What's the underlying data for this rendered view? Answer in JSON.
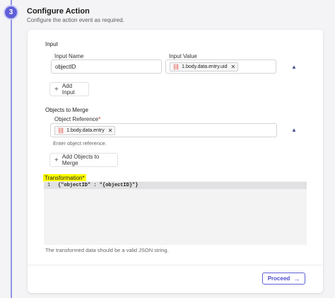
{
  "step": {
    "number": "3",
    "title": "Configure Action",
    "subtitle": "Configure the action event as required."
  },
  "input_section": {
    "title": "Input",
    "name_label": "Input Name",
    "value_label": "Input Value",
    "name_value": "objectID",
    "value_chip": "1.body.data.entry.uid",
    "add_label": "Add Input"
  },
  "merge_section": {
    "title": "Objects to Merge",
    "reference_label": "Object Reference",
    "reference_chip": "1.body.data.entry",
    "help": "Enter object reference.",
    "add_label": "Add Objects to Merge"
  },
  "transformation": {
    "label": "Transformation",
    "line_number": "1",
    "code": "{\"objectID\" : \"{objectID}\"}",
    "help": "The transformed data should be a valid JSON string."
  },
  "proceed_label": "Proceed",
  "colors": {
    "accent": "#5f5fd8",
    "highlight": "#ffff00",
    "required": "#d32f2f"
  }
}
